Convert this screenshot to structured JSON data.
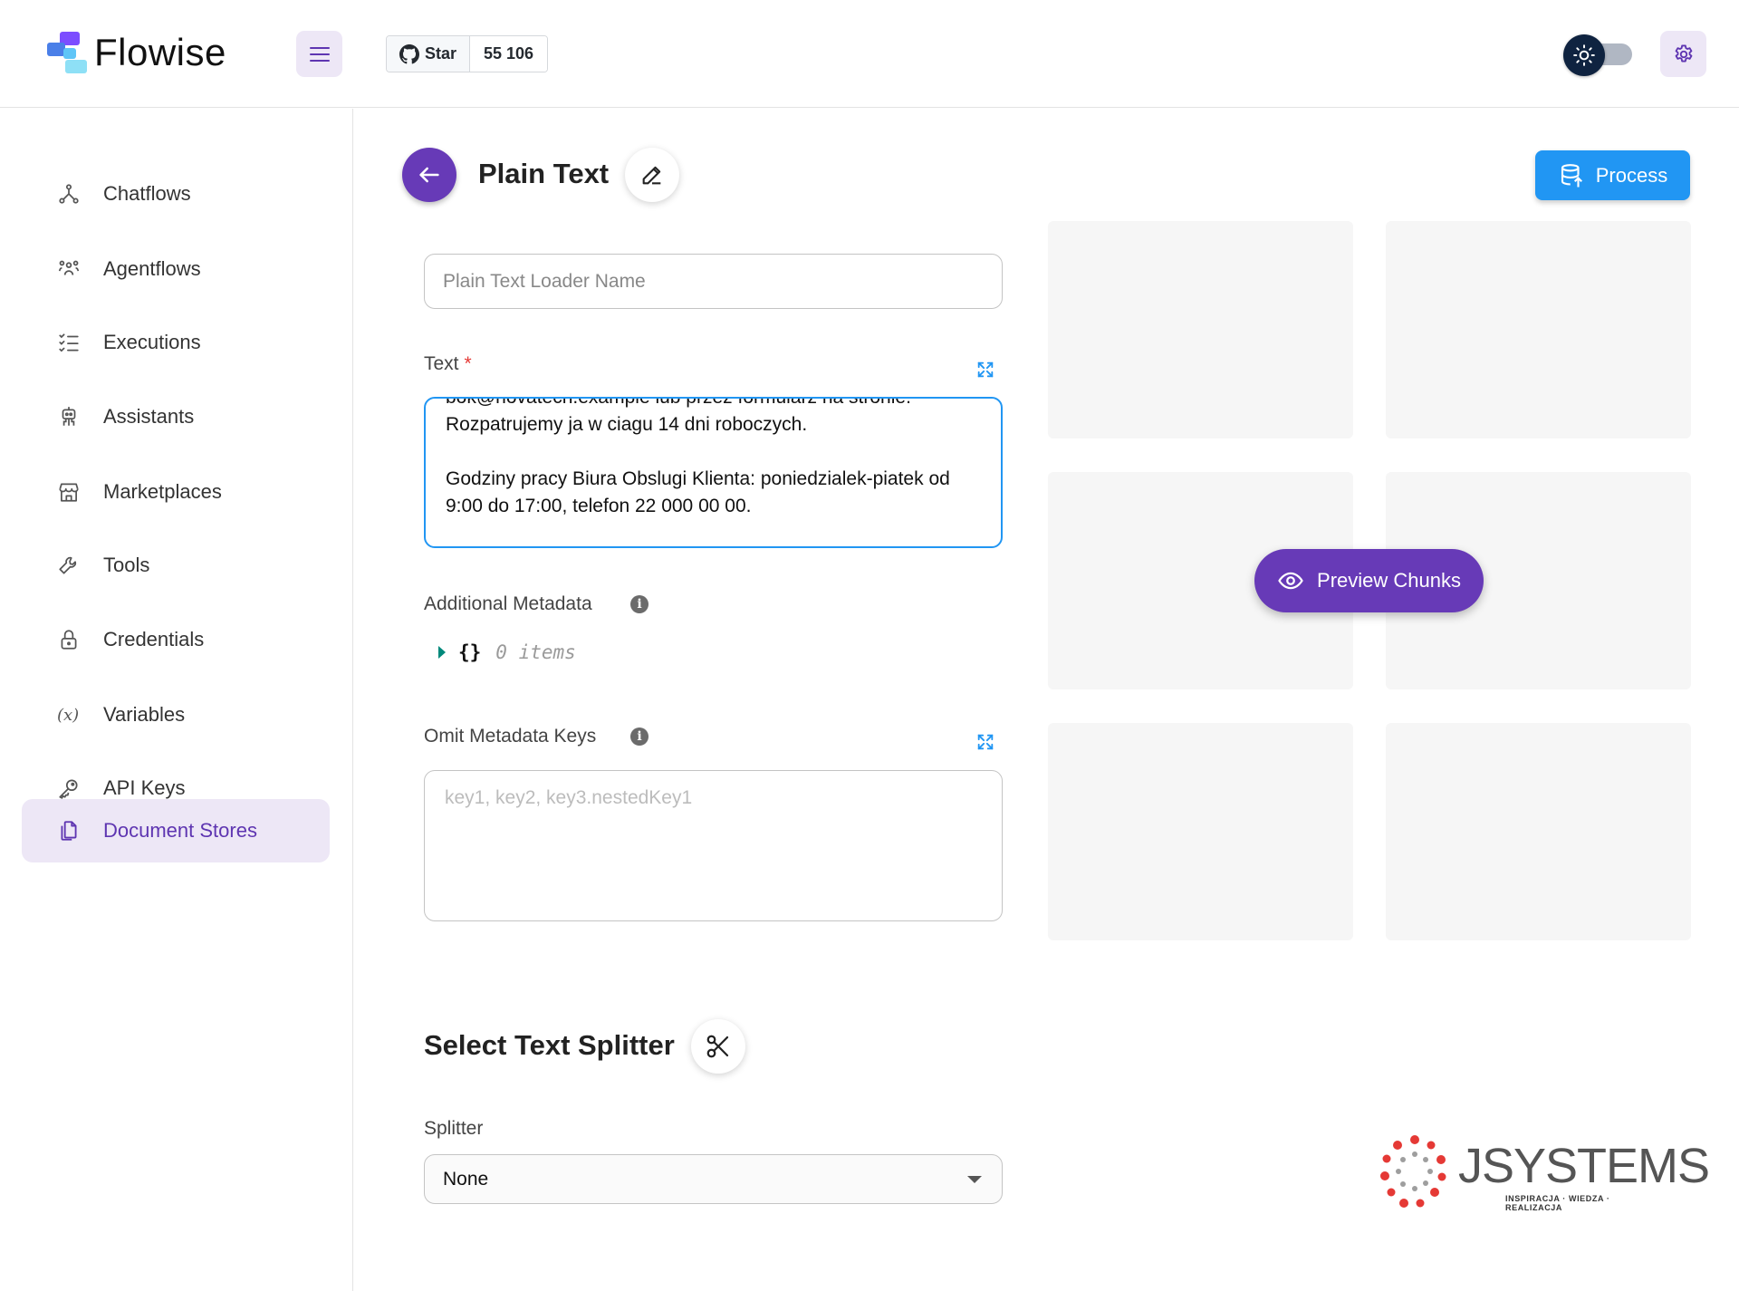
{
  "app": {
    "name": "Flowise"
  },
  "github": {
    "star_label": "Star",
    "star_count": "55 106"
  },
  "sidebar": {
    "items": [
      {
        "label": "Chatflows",
        "icon": "chatflows-icon"
      },
      {
        "label": "Agentflows",
        "icon": "agentflows-icon"
      },
      {
        "label": "Executions",
        "icon": "executions-icon"
      },
      {
        "label": "Assistants",
        "icon": "assistants-icon"
      },
      {
        "label": "Marketplaces",
        "icon": "marketplaces-icon"
      },
      {
        "label": "Tools",
        "icon": "tools-icon"
      },
      {
        "label": "Credentials",
        "icon": "credentials-icon"
      },
      {
        "label": "Variables",
        "icon": "variables-icon"
      },
      {
        "label": "API Keys",
        "icon": "api-keys-icon"
      },
      {
        "label": "Document Stores",
        "icon": "document-stores-icon",
        "active": true
      }
    ]
  },
  "page": {
    "title": "Plain Text",
    "process_label": "Process",
    "name_input": {
      "placeholder": "Plain Text Loader Name",
      "value": ""
    },
    "text_field": {
      "label": "Text",
      "required_mark": "*",
      "value": "bok@novatech.example lub przez formularz na stronie.\nRozpatrujemy ja w ciagu 14 dni roboczych.\n\nGodziny pracy Biura Obslugi Klienta: poniedzialek-piatek od 9:00 do 17:00, telefon 22 000 00 00."
    },
    "additional_metadata": {
      "label": "Additional Metadata",
      "info": "i",
      "braces": "{}",
      "count": "0 items"
    },
    "omit_metadata": {
      "label": "Omit Metadata Keys",
      "info": "i",
      "placeholder": "key1, key2, key3.nestedKey1"
    },
    "preview_label": "Preview Chunks",
    "splitter_section": {
      "title": "Select Text Splitter",
      "label": "Splitter",
      "value": "None"
    }
  },
  "brand": {
    "name": "JSYSTEMS",
    "tagline": "INSPIRACJA · WIEDZA · REALIZACJA"
  },
  "colors": {
    "primary": "#673ab7",
    "accent": "#2196f3",
    "active_bg": "#ede7f6"
  }
}
